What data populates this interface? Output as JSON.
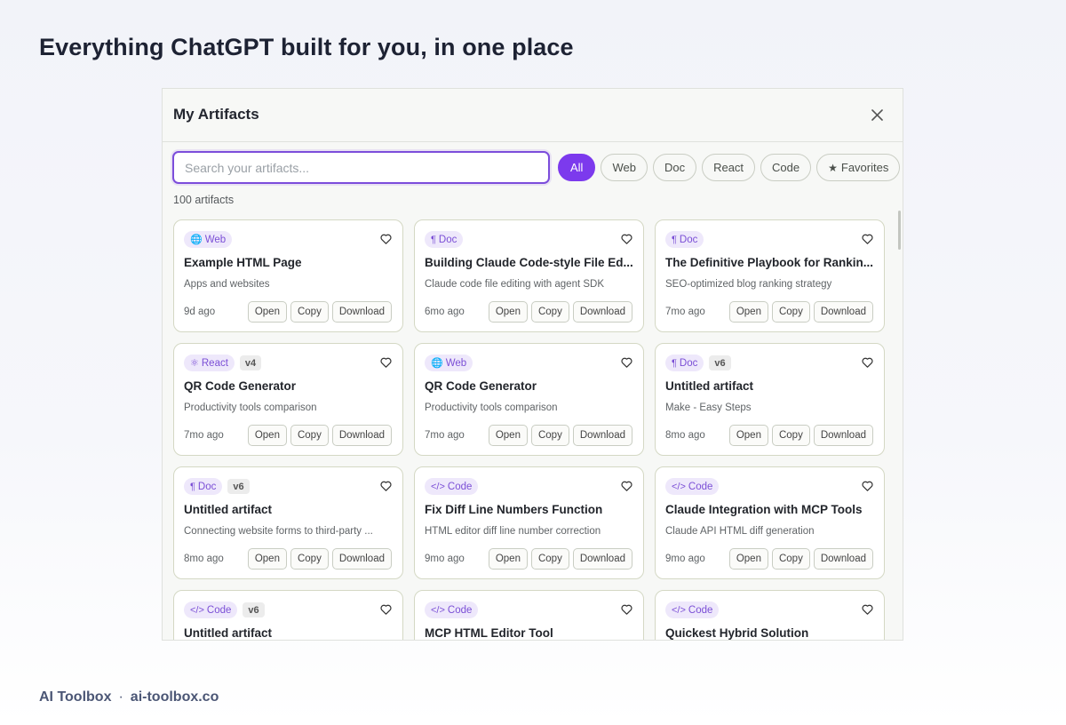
{
  "headline": "Everything ChatGPT built for you, in one place",
  "modal": {
    "title": "My Artifacts",
    "search_placeholder": "Search your artifacts...",
    "filters": [
      "All",
      "Web",
      "Doc",
      "React",
      "Code",
      "Favorites"
    ],
    "active_filter": "All",
    "count_label": "100 artifacts",
    "accent_color": "#7c3aed",
    "button_labels": {
      "open": "Open",
      "copy": "Copy",
      "download": "Download"
    },
    "cards": [
      {
        "type": "Web",
        "type_icon": "globe-icon",
        "version": "",
        "title": "Example HTML Page",
        "description": "Apps and websites",
        "time": "9d ago"
      },
      {
        "type": "Doc",
        "type_icon": "pilcrow-icon",
        "version": "",
        "title": "Building Claude Code-style File Ed...",
        "description": "Claude code file editing with agent SDK",
        "time": "6mo ago"
      },
      {
        "type": "Doc",
        "type_icon": "pilcrow-icon",
        "version": "",
        "title": "The Definitive Playbook for Rankin...",
        "description": "SEO-optimized blog ranking strategy",
        "time": "7mo ago"
      },
      {
        "type": "React",
        "type_icon": "atom-icon",
        "version": "v4",
        "title": "QR Code Generator",
        "description": "Productivity tools comparison",
        "time": "7mo ago"
      },
      {
        "type": "Web",
        "type_icon": "globe-icon",
        "version": "",
        "title": "QR Code Generator",
        "description": "Productivity tools comparison",
        "time": "7mo ago"
      },
      {
        "type": "Doc",
        "type_icon": "pilcrow-icon",
        "version": "v6",
        "title": "Untitled artifact",
        "description": "Make - Easy Steps",
        "time": "8mo ago"
      },
      {
        "type": "Doc",
        "type_icon": "pilcrow-icon",
        "version": "v6",
        "title": "Untitled artifact",
        "description": "Connecting website forms to third-party ...",
        "time": "8mo ago"
      },
      {
        "type": "Code",
        "type_icon": "code-icon",
        "version": "",
        "title": "Fix Diff Line Numbers Function",
        "description": "HTML editor diff line number correction",
        "time": "9mo ago"
      },
      {
        "type": "Code",
        "type_icon": "code-icon",
        "version": "",
        "title": "Claude Integration with MCP Tools",
        "description": "Claude API HTML diff generation",
        "time": "9mo ago"
      },
      {
        "type": "Code",
        "type_icon": "code-icon",
        "version": "v6",
        "title": "Untitled artifact",
        "description": "",
        "time": ""
      },
      {
        "type": "Code",
        "type_icon": "code-icon",
        "version": "",
        "title": "MCP HTML Editor Tool",
        "description": "",
        "time": ""
      },
      {
        "type": "Code",
        "type_icon": "code-icon",
        "version": "",
        "title": "Quickest Hybrid Solution",
        "description": "",
        "time": ""
      }
    ]
  },
  "footer": {
    "brand": "AI Toolbox",
    "separator": "·",
    "site": "ai-toolbox.co"
  }
}
